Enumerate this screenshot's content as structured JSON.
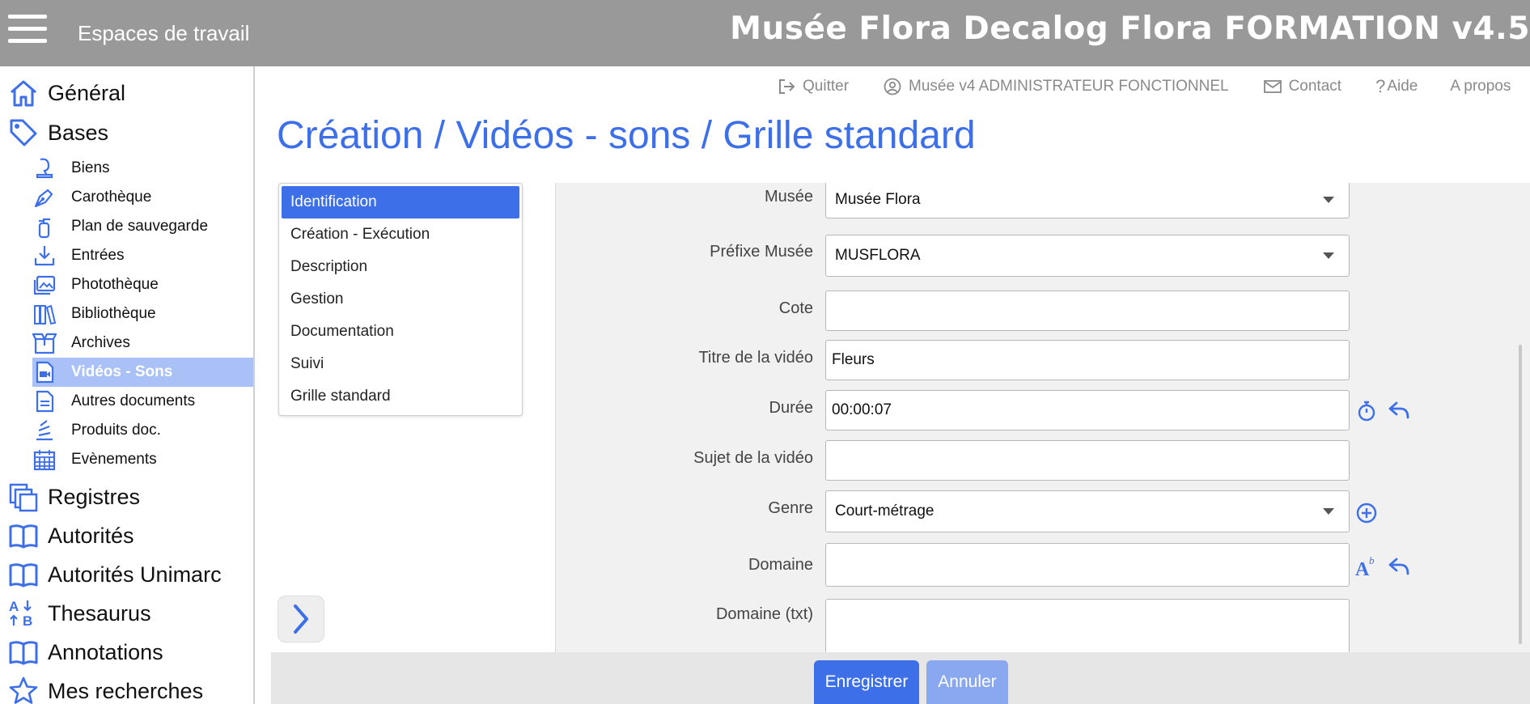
{
  "header": {
    "menu_icon": "hamburger-icon",
    "workspaces_label": "Espaces de travail",
    "app_title": "Musée Flora Decalog Flora FORMATION v4.5",
    "bar_color": "#999999"
  },
  "top_links": [
    {
      "icon": "logout-icon",
      "label": "Quitter"
    },
    {
      "icon": "user-circle-icon",
      "label": "Musée v4 ADMINISTRATEUR FONCTIONNEL"
    },
    {
      "icon": "envelope-icon",
      "label": "Contact"
    },
    {
      "icon": "question-icon",
      "label": "Aide"
    },
    {
      "icon": "",
      "label": "A propos"
    }
  ],
  "sidebar": {
    "top_items": [
      {
        "icon": "home-icon",
        "label": "Général"
      },
      {
        "icon": "tag-icon",
        "label": "Bases"
      }
    ],
    "sub_items": [
      {
        "icon": "bust-icon",
        "label": "Biens"
      },
      {
        "icon": "pen-nib-icon",
        "label": "Carothèque"
      },
      {
        "icon": "fire-extinguisher-icon",
        "label": "Plan de sauvegarde"
      },
      {
        "icon": "download-tray-icon",
        "label": "Entrées"
      },
      {
        "icon": "images-icon",
        "label": "Photothèque"
      },
      {
        "icon": "books-icon",
        "label": "Bibliothèque"
      },
      {
        "icon": "open-box-icon",
        "label": "Archives"
      },
      {
        "icon": "video-file-icon",
        "label": "Vidéos - Sons",
        "active": true
      },
      {
        "icon": "document-icon",
        "label": "Autres documents"
      },
      {
        "icon": "stacked-docs-icon",
        "label": "Produits doc."
      },
      {
        "icon": "calendar-icon",
        "label": "Evènements"
      }
    ],
    "bottom_items": [
      {
        "icon": "registers-icon",
        "label": "Registres"
      },
      {
        "icon": "open-book-icon",
        "label": "Autorités"
      },
      {
        "icon": "open-book-icon",
        "label": "Autorités Unimarc"
      },
      {
        "icon": "sort-az-icon",
        "label": "Thesaurus"
      },
      {
        "icon": "open-book-icon",
        "label": "Annotations"
      },
      {
        "icon": "star-icon",
        "label": "Mes recherches"
      }
    ],
    "active_color": "#a9c1f7"
  },
  "page_title": "Création / Vidéos - sons / Grille standard",
  "tabs": [
    {
      "label": "Identification",
      "active": true
    },
    {
      "label": "Création - Exécution"
    },
    {
      "label": "Description"
    },
    {
      "label": "Gestion"
    },
    {
      "label": "Documentation"
    },
    {
      "label": "Suivi"
    },
    {
      "label": "Grille standard"
    }
  ],
  "form": {
    "fields": [
      {
        "label": "Musée",
        "value": "Musée Flora",
        "type": "select"
      },
      {
        "label": "Préfixe Musée",
        "value": "MUSFLORA",
        "type": "select"
      },
      {
        "label": "Cote",
        "value": "",
        "type": "text"
      },
      {
        "label": "Titre de la vidéo",
        "value": "Fleurs",
        "type": "text"
      },
      {
        "label": "Durée",
        "value": "00:00:07",
        "type": "text",
        "actions": [
          "stopwatch-icon",
          "undo-arrow-icon"
        ]
      },
      {
        "label": "Sujet de la vidéo",
        "value": "",
        "type": "text"
      },
      {
        "label": "Genre",
        "value": "Court-métrage",
        "type": "select",
        "actions": [
          "plus-circle-icon"
        ]
      },
      {
        "label": "Domaine",
        "value": "",
        "type": "text",
        "actions": [
          "text-format-icon",
          "undo-arrow-icon"
        ]
      },
      {
        "label": "Domaine (txt)",
        "value": "",
        "type": "textarea"
      }
    ]
  },
  "buttons": {
    "save_label": "Enregistrer",
    "cancel_label": "Annuler",
    "expand_icon": "chevron-right-icon"
  },
  "colors": {
    "accent": "#3d6fe8",
    "accent_light": "#8aa8f0"
  }
}
